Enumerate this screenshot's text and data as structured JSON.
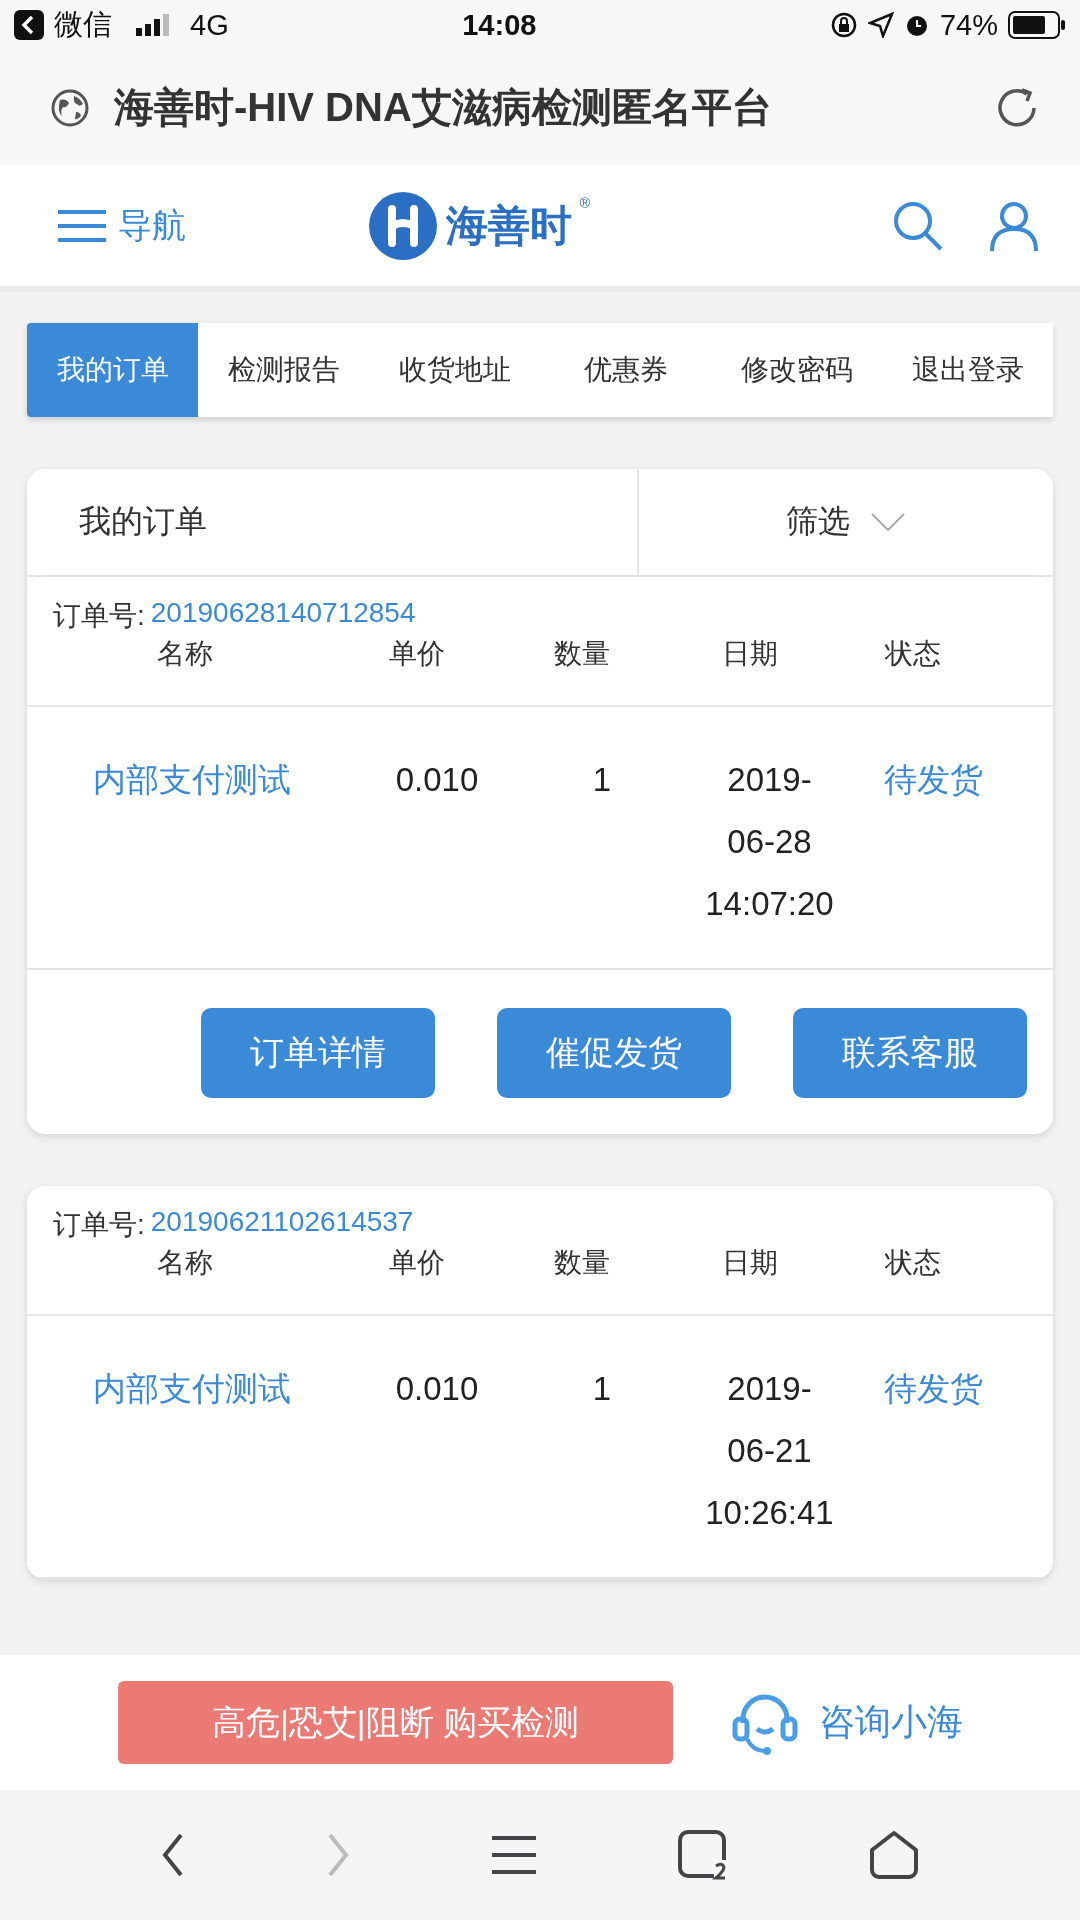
{
  "status_bar": {
    "back_app": "微信",
    "network": "4G",
    "time": "14:08",
    "battery": "74%"
  },
  "browser": {
    "title": "海善时-HIV DNA艾滋病检测匿名平台"
  },
  "header": {
    "nav_label": "导航",
    "logo_text": "海善时",
    "logo_mark": "®"
  },
  "tabs": [
    {
      "label": "我的订单",
      "selected": true
    },
    {
      "label": "检测报告",
      "selected": false
    },
    {
      "label": "收货地址",
      "selected": false
    },
    {
      "label": "优惠券",
      "selected": false
    },
    {
      "label": "修改密码",
      "selected": false
    },
    {
      "label": "退出登录",
      "selected": false
    }
  ],
  "orders_panel": {
    "title": "我的订单",
    "filter": "筛选"
  },
  "orders": [
    {
      "number_label": "订单号:",
      "number": "20190628140712854",
      "columns": [
        "名称",
        "单价",
        "数量",
        "日期",
        "状态"
      ],
      "name": "内部支付测试",
      "price": "0.010",
      "quantity": "1",
      "date": "2019-06-28 14:07:20",
      "status": "待发货",
      "buttons": [
        "订单详情",
        "催促发货",
        "联系客服"
      ]
    },
    {
      "number_label": "订单号:",
      "number": "20190621102614537",
      "columns": [
        "名称",
        "单价",
        "数量",
        "日期",
        "状态"
      ],
      "name": "内部支付测试",
      "price": "0.010",
      "quantity": "1",
      "date": "2019-06-21 10:26:41",
      "status": "待发货"
    }
  ],
  "bottom_bar": {
    "buy_button": "高危|恐艾|阻断 购买检测",
    "consult": "咨询小海"
  }
}
